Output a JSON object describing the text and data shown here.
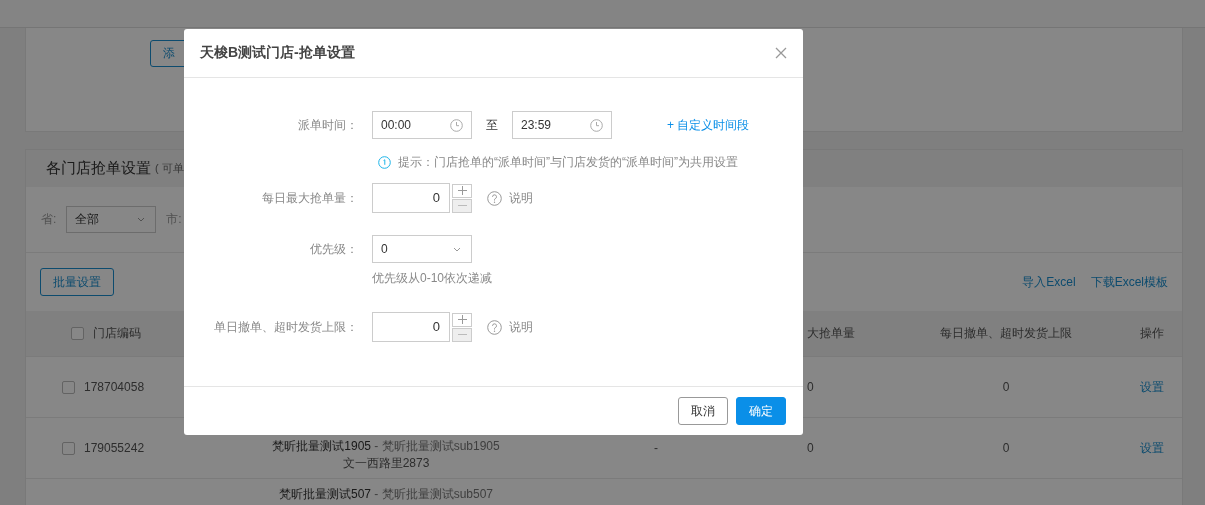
{
  "page": {
    "add_button": "添",
    "section_title": "各门店抢单设置",
    "section_note": "( 可单",
    "filters": [
      {
        "label": "省:",
        "value": "全部"
      },
      {
        "label": "市:"
      }
    ],
    "batch_button": "批量设置",
    "links": [
      "导入Excel",
      "下载Excel模板"
    ],
    "table": {
      "header_checked": false,
      "columns": [
        {
          "label": "门店编码"
        },
        {
          "label": "大抢单量"
        },
        {
          "label": "每日撤单、超时发货上限"
        },
        {
          "label": "操作"
        }
      ],
      "rows": [
        {
          "checked": false,
          "code": "178704058",
          "max_orders": "0",
          "daily_limit": "0",
          "action": "设置"
        },
        {
          "checked": false,
          "code": "179055242",
          "store_name": "梵昕批量测试1905",
          "store_sub": "- 梵昕批量测试sub1905",
          "address": "文一西路里2873",
          "region": "-",
          "max_orders": "0",
          "daily_limit": "0",
          "action": "设置"
        },
        {
          "store_name": "梵昕批量测试507",
          "store_sub": "- 梵昕批量测试sub507"
        }
      ]
    }
  },
  "dialog": {
    "title": "天梭B测试门店-抢单设置",
    "fields": [
      {
        "kind": "time_range",
        "label": "派单时间：",
        "start": "00:00",
        "separator": "至",
        "end": "23:59",
        "link": "+ 自定义时间段",
        "tip": "提示：门店抢单的“派单时间”与门店发货的“派单时间”为共用设置"
      },
      {
        "kind": "number",
        "label": "每日最大抢单量：",
        "value": "0",
        "decrease_disabled": true,
        "help": "说明"
      },
      {
        "kind": "select",
        "label": "优先级：",
        "value": "0",
        "hint": "优先级从0-10依次递减"
      },
      {
        "kind": "number",
        "label": "单日撤单、超时发货上限：",
        "value": "0",
        "decrease_disabled": true,
        "help": "说明"
      }
    ],
    "buttons": [
      {
        "kind": "secondary",
        "label": "取消"
      },
      {
        "kind": "primary",
        "label": "确定"
      }
    ]
  }
}
